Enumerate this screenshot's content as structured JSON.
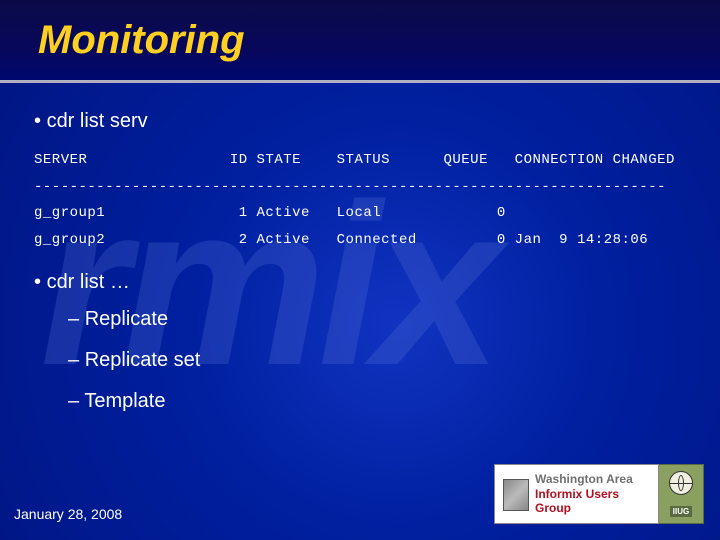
{
  "title": "Monitoring",
  "watermark": "rmix",
  "bullets": {
    "b1": "cdr list serv",
    "b2": "cdr list …"
  },
  "table": {
    "header": "SERVER                ID STATE    STATUS      QUEUE   CONNECTION CHANGED",
    "divider": "-----------------------------------------------------------------------",
    "row1": "g_group1               1 Active   Local             0",
    "row2": "g_group2               2 Active   Connected         0 Jan  9 14:28:06"
  },
  "sublist": {
    "s1": "Replicate",
    "s2": "Replicate set",
    "s3": "Template"
  },
  "footer": {
    "date": "January 28, 2008",
    "logo_line1": "Washington Area",
    "logo_line2": "Informix Users Group",
    "iiug": "IIUG"
  }
}
